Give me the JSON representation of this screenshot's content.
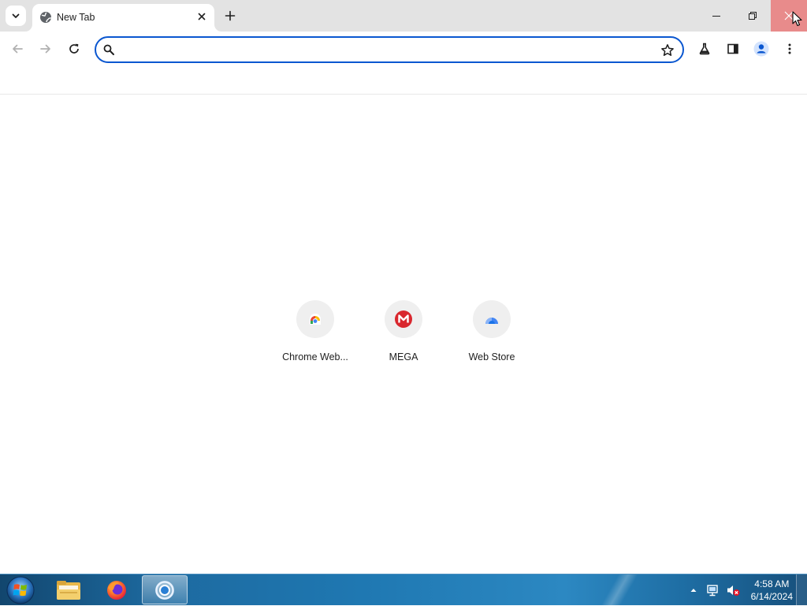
{
  "tab_strip": {
    "tab_search_icon": "chevron-down-icon",
    "tabs": [
      {
        "title": "New Tab",
        "favicon": "globe-icon",
        "close_icon": "close-icon"
      }
    ],
    "new_tab_icon": "plus-icon",
    "window_controls": [
      "minimize-icon",
      "restore-icon",
      "close-icon"
    ]
  },
  "toolbar": {
    "back_icon": "arrow-left-icon",
    "forward_icon": "arrow-right-icon",
    "reload_icon": "reload-icon",
    "omnibox": {
      "value": "",
      "placeholder": "",
      "search_icon": "search-icon",
      "bookmark_icon": "star-icon"
    },
    "right_icons": [
      "labs-flask-icon",
      "side-panel-icon",
      "profile-icon",
      "menu-dots-icon"
    ]
  },
  "shortcuts": [
    {
      "label": "Chrome Web...",
      "icon": "chrome-web-store-icon"
    },
    {
      "label": "MEGA",
      "icon": "mega-icon"
    },
    {
      "label": "Web Store",
      "icon": "web-store-icon"
    }
  ],
  "taskbar": {
    "start_icon": "windows-start-icon",
    "apps": [
      {
        "name": "file-explorer-icon",
        "active": false
      },
      {
        "name": "firefox-icon",
        "active": false
      },
      {
        "name": "chrome-icon",
        "active": true
      }
    ],
    "tray_icons": [
      "show-hidden-icons-arrow",
      "network-icon",
      "volume-muted-icon"
    ],
    "clock": {
      "time": "4:58 AM",
      "date": "6/14/2024"
    }
  },
  "colors": {
    "tabstrip_bg": "#e3e3e3",
    "omnibox_focus": "#0b57d0",
    "close_hover": "#e88b8b",
    "mega_red": "#d9272e"
  }
}
